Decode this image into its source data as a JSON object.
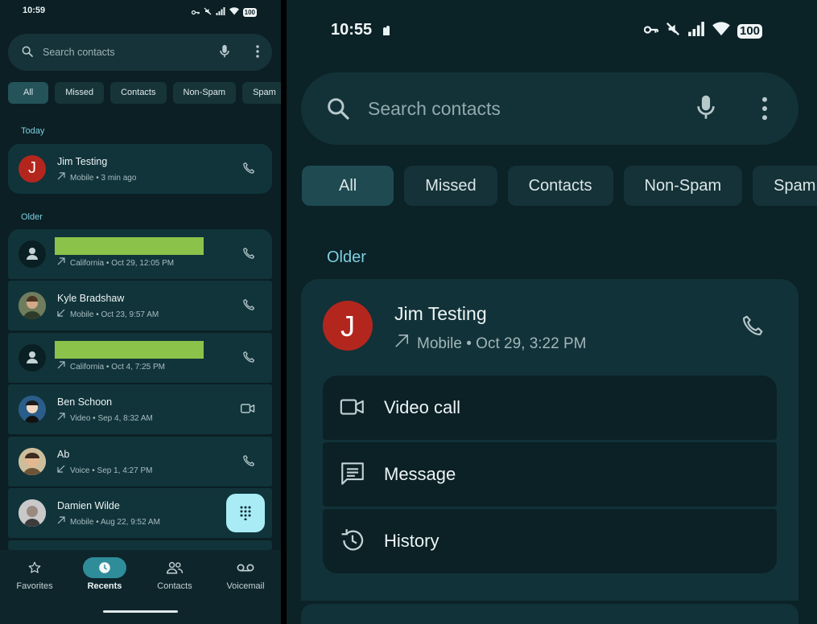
{
  "left": {
    "status_time": "10:59",
    "battery": "100",
    "search_placeholder": "Search contacts",
    "chips": [
      "All",
      "Missed",
      "Contacts",
      "Non-Spam",
      "Spam"
    ],
    "section_today": "Today",
    "section_older": "Older",
    "calls": [
      {
        "name": "Jim Testing",
        "detail": "Mobile • 3 min ago",
        "avatar_letter": "J",
        "direction": "outgoing",
        "action_icon": "phone-icon"
      },
      {
        "name": "",
        "detail": "California • Oct 29, 12:05 PM",
        "direction": "outgoing",
        "action_icon": "phone-icon",
        "redacted": true
      },
      {
        "name": "Kyle Bradshaw",
        "detail": "Mobile • Oct 23, 9:57 AM",
        "direction": "incoming",
        "action_icon": "phone-icon"
      },
      {
        "name": "",
        "detail": "California • Oct 4, 7:25 PM",
        "direction": "outgoing",
        "action_icon": "phone-icon",
        "redacted": true
      },
      {
        "name": "Ben Schoon",
        "detail": "Video • Sep 4, 8:32 AM",
        "direction": "outgoing",
        "action_icon": "video-icon"
      },
      {
        "name": "Ab",
        "detail": "Voice • Sep 1, 4:27 PM",
        "direction": "incoming",
        "action_icon": "phone-icon"
      },
      {
        "name": "Damien Wilde",
        "detail": "Mobile • Aug 22, 9:52 AM",
        "direction": "outgoing",
        "action_icon": "dialpad-icon"
      }
    ],
    "nav": [
      "Favorites",
      "Recents",
      "Contacts",
      "Voicemail"
    ],
    "nav_active": "Recents",
    "accent": "#2f8d9a",
    "redaction_color": "#8bc34a"
  },
  "right": {
    "status_time": "10:55",
    "battery": "100",
    "search_placeholder": "Search contacts",
    "chips": [
      "All",
      "Missed",
      "Contacts",
      "Non-Spam",
      "Spam"
    ],
    "section_older": "Older",
    "contact": {
      "name": "Jim Testing",
      "avatar_letter": "J",
      "detail": "Mobile • Oct 29, 3:22 PM",
      "avatar_color": "#b3261e"
    },
    "options": [
      "Video call",
      "Message",
      "History"
    ]
  }
}
